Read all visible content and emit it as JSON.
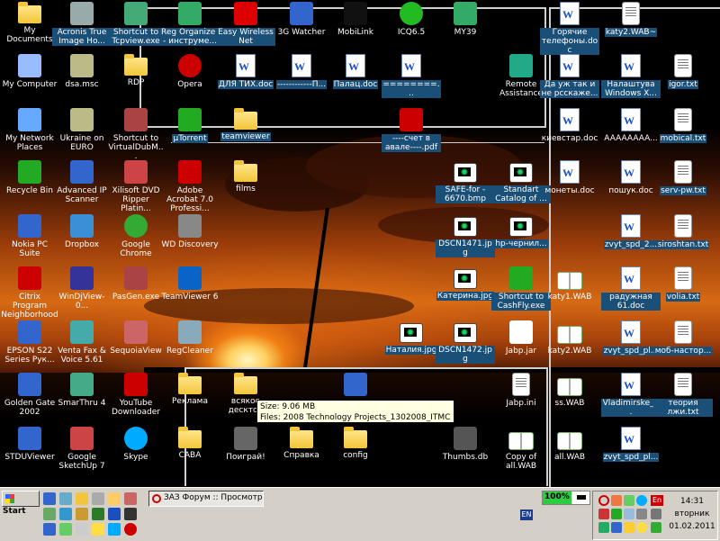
{
  "desktop": {
    "icons": [
      {
        "id": "my-documents",
        "label": "My Documents",
        "icon": "folder-docs-icon",
        "color": "#f2c53a"
      },
      {
        "id": "acronis",
        "label": "Acronis True Image Ho...",
        "icon": "acronis-disk-icon",
        "color": "#9aa"
      },
      {
        "id": "tcpview",
        "label": "Shortcut to Tcpview.exe",
        "icon": "network-icon",
        "color": "#4a7"
      },
      {
        "id": "reg-organizer",
        "label": "Reg Organizer - инструме...",
        "icon": "reg-cube-icon",
        "color": "#3a6"
      },
      {
        "id": "easy-wireless",
        "label": "Easy Wireless Net",
        "icon": "wireless-icon",
        "color": "#d00"
      },
      {
        "id": "3g-watcher",
        "label": "3G Watcher",
        "icon": "3g-icon",
        "color": "#36c"
      },
      {
        "id": "mobilink",
        "label": "MobiLink",
        "icon": "mobilink-icon",
        "color": "#111"
      },
      {
        "id": "icq",
        "label": "ICQ6.5",
        "icon": "icq-flower-icon",
        "color": "#2b2"
      },
      {
        "id": "my39",
        "label": "MY39",
        "icon": "network-globe-icon",
        "color": "#3a6"
      },
      {
        "id": "goryachie",
        "label": "Горячие телефоны.doc",
        "icon": "word-doc-icon",
        "color": "#1b4fbd"
      },
      {
        "id": "katy2-wab-tilde",
        "label": "katy2.WAB~",
        "icon": "wab-file-icon",
        "color": "#fff"
      },
      {
        "id": "my-computer",
        "label": "My Computer",
        "icon": "computer-icon",
        "color": "#9bf"
      },
      {
        "id": "dsa-msc",
        "label": "dsa.msc",
        "icon": "msc-icon",
        "color": "#bb8"
      },
      {
        "id": "rdp",
        "label": "RDP",
        "icon": "folder-icon",
        "color": "#f2c53a"
      },
      {
        "id": "opera",
        "label": "Opera",
        "icon": "opera-icon",
        "color": "#c00"
      },
      {
        "id": "dlya-tih",
        "label": "ДЛЯ ТИХ.doc",
        "icon": "word-doc-icon",
        "color": "#1b4fbd"
      },
      {
        "id": "dash-p",
        "label": "------------П...",
        "icon": "word-doc-icon",
        "color": "#1b4fbd"
      },
      {
        "id": "palats",
        "label": "Палац.doc",
        "icon": "word-doc-icon",
        "color": "#1b4fbd"
      },
      {
        "id": "equals",
        "label": "========...",
        "icon": "word-doc-icon",
        "color": "#1b4fbd"
      },
      {
        "id": "remote-assist",
        "label": "Remote Assistance",
        "icon": "remote-assistance-icon",
        "color": "#2a8"
      },
      {
        "id": "da-uzh",
        "label": "Да уж так и не рсскаже...",
        "icon": "word-doc-icon",
        "color": "#1b4fbd"
      },
      {
        "id": "nalashtuv",
        "label": "Налаштува Windows X...",
        "icon": "word-doc-icon",
        "color": "#1b4fbd"
      },
      {
        "id": "igor-txt",
        "label": "igor.txt",
        "icon": "text-file-icon",
        "color": "#fff"
      },
      {
        "id": "my-network",
        "label": "My Network Places",
        "icon": "network-places-icon",
        "color": "#6af"
      },
      {
        "id": "ukraine-euro",
        "label": "Ukraine on EURO",
        "icon": "msc-icon",
        "color": "#bb8"
      },
      {
        "id": "virtualdub",
        "label": "Shortcut to VirtualDubM...",
        "icon": "virtualdub-icon",
        "color": "#a44"
      },
      {
        "id": "utorrent",
        "label": "µTorrent",
        "icon": "utorrent-icon",
        "color": "#2a2"
      },
      {
        "id": "teamviewer-folder",
        "label": "teamviewer",
        "icon": "folder-icon",
        "color": "#f2c53a"
      },
      {
        "id": "schet-pdf",
        "label": "----счет в авале----.pdf",
        "icon": "pdf-icon",
        "color": "#c00"
      },
      {
        "id": "kyivstar",
        "label": "киевстар.doc",
        "icon": "word-doc-icon",
        "color": "#1b4fbd"
      },
      {
        "id": "aaaaa",
        "label": "AAAAAAAA...",
        "icon": "word-doc-icon",
        "color": "#1b4fbd"
      },
      {
        "id": "mobical",
        "label": "mobical.txt",
        "icon": "text-file-icon",
        "color": "#fff"
      },
      {
        "id": "recycle",
        "label": "Recycle Bin",
        "icon": "recycle-bin-icon",
        "color": "#2a2"
      },
      {
        "id": "adv-ip",
        "label": "Advanced IP Scanner",
        "icon": "ip-scanner-icon",
        "color": "#36c"
      },
      {
        "id": "xilisoft",
        "label": "Xilisoft DVD Ripper Platin...",
        "icon": "dvd-ripper-icon",
        "color": "#c44"
      },
      {
        "id": "acrobat",
        "label": "Adobe Acrobat 7.0 Professi...",
        "icon": "acrobat-icon",
        "color": "#c00"
      },
      {
        "id": "films",
        "label": "films",
        "icon": "folder-icon",
        "color": "#f2c53a"
      },
      {
        "id": "safe-for",
        "label": "SAFE-for - 6670.bmp",
        "icon": "image-file-icon",
        "color": "#fff"
      },
      {
        "id": "standart-catalog",
        "label": "Standart Catalog of ...",
        "icon": "djvu-icon",
        "color": "#fff"
      },
      {
        "id": "monety",
        "label": "монеты.doc",
        "icon": "word-doc-icon",
        "color": "#1b4fbd"
      },
      {
        "id": "poshuk",
        "label": "пошук.doc",
        "icon": "word-doc-icon",
        "color": "#1b4fbd"
      },
      {
        "id": "serv-pw",
        "label": "serv-pw.txt",
        "icon": "text-file-icon",
        "color": "#fff"
      },
      {
        "id": "nokia-pc",
        "label": "Nokia PC Suite",
        "icon": "nokia-icon",
        "color": "#36c"
      },
      {
        "id": "dropbox",
        "label": "Dropbox",
        "icon": "dropbox-icon",
        "color": "#3a8fd6"
      },
      {
        "id": "chrome",
        "label": "Google Chrome",
        "icon": "chrome-icon",
        "color": "#3a3"
      },
      {
        "id": "wd-discovery",
        "label": "WD Discovery",
        "icon": "magnifier-icon",
        "color": "#888"
      },
      {
        "id": "dscn1471",
        "label": "DSCN1471.jpg",
        "icon": "image-file-icon",
        "color": "#fff"
      },
      {
        "id": "hp-chernil",
        "label": "hp-чернил...",
        "icon": "image-file-icon",
        "color": "#fff"
      },
      {
        "id": "zvyt-spd-2",
        "label": "zvyt_spd_2...",
        "icon": "word-doc-icon",
        "color": "#1b4fbd"
      },
      {
        "id": "siroshtan",
        "label": "siroshtan.txt",
        "icon": "text-file-icon",
        "color": "#fff"
      },
      {
        "id": "citrix",
        "label": "Citrix Program Neighborhood",
        "icon": "citrix-icon",
        "color": "#c00"
      },
      {
        "id": "windjview",
        "label": "WinDjView-0...",
        "icon": "windjview-icon",
        "color": "#339"
      },
      {
        "id": "pasgen",
        "label": "PasGen.exe",
        "icon": "pasgen-icon",
        "color": "#a44"
      },
      {
        "id": "teamviewer6",
        "label": "TeamViewer 6",
        "icon": "teamviewer-icon",
        "color": "#0a64c8"
      },
      {
        "id": "katerina",
        "label": "Катерина.jpg",
        "icon": "image-file-icon",
        "color": "#fff"
      },
      {
        "id": "cashfly",
        "label": "Shortcut to CashFly.exe",
        "icon": "cashfly-icon",
        "color": "#2a2"
      },
      {
        "id": "katy1-wab",
        "label": "katy1.WAB",
        "icon": "address-book-icon",
        "color": "#fff"
      },
      {
        "id": "radujnaya",
        "label": "радужная 61.doc",
        "icon": "word-doc-icon",
        "color": "#1b4fbd"
      },
      {
        "id": "volia",
        "label": "volia.txt",
        "icon": "text-file-icon",
        "color": "#fff"
      },
      {
        "id": "epson",
        "label": "EPSON S22 Series Рук...",
        "icon": "epson-icon",
        "color": "#36c"
      },
      {
        "id": "venta-fax",
        "label": "Venta Fax & Voice 5.61",
        "icon": "fax-icon",
        "color": "#4aa"
      },
      {
        "id": "sequoia",
        "label": "SequoiaView",
        "icon": "sequoia-icon",
        "color": "#c66"
      },
      {
        "id": "regcleaner",
        "label": "RegCleaner",
        "icon": "regcleaner-icon",
        "color": "#8ab"
      },
      {
        "id": "nataliya",
        "label": "Наталия.jpg",
        "icon": "image-file-icon",
        "color": "#fff"
      },
      {
        "id": "dscn1472",
        "label": "DSCN1472.jpg",
        "icon": "image-file-icon",
        "color": "#fff"
      },
      {
        "id": "jabp-jar",
        "label": "Jabp.jar",
        "icon": "jar-icon",
        "color": "#fff"
      },
      {
        "id": "katy2-wab",
        "label": "katy2.WAB",
        "icon": "address-book-icon",
        "color": "#fff"
      },
      {
        "id": "zvyt-spd-pl",
        "label": "zvyt_spd_pl...",
        "icon": "word-doc-icon",
        "color": "#1b4fbd"
      },
      {
        "id": "mob-nastor",
        "label": "моб-настор...",
        "icon": "text-file-icon",
        "color": "#fff"
      },
      {
        "id": "golden-gate",
        "label": "Golden Gate 2002",
        "icon": "golden-gate-icon",
        "color": "#36c"
      },
      {
        "id": "smarthru",
        "label": "SmarThru 4",
        "icon": "smarthru-icon",
        "color": "#4a8"
      },
      {
        "id": "youtube-dl",
        "label": "YouTube Downloader",
        "icon": "youtube-downloader-icon",
        "color": "#c00"
      },
      {
        "id": "reklama",
        "label": "Реклама",
        "icon": "folder-icon",
        "color": "#f2c53a"
      },
      {
        "id": "vsyakoe",
        "label": "всякое десктоп",
        "icon": "folder-icon",
        "color": "#f2c53a"
      },
      {
        "id": "ie-icon",
        "label": "",
        "icon": "internet-explorer-icon",
        "color": "#36c"
      },
      {
        "id": "jabp-ini",
        "label": "Jabp.ini",
        "icon": "ini-file-icon",
        "color": "#fff"
      },
      {
        "id": "ss-wab",
        "label": "ss.WAB",
        "icon": "address-book-icon",
        "color": "#fff"
      },
      {
        "id": "vladimirske",
        "label": "Vladimirske_...",
        "icon": "word-doc-icon",
        "color": "#1b4fbd"
      },
      {
        "id": "teoriya",
        "label": "теория лжи.txt",
        "icon": "text-file-icon",
        "color": "#fff"
      },
      {
        "id": "stduviewer",
        "label": "STDUViewer",
        "icon": "stduviewer-icon",
        "color": "#36c"
      },
      {
        "id": "sketchup",
        "label": "Google SketchUp 7",
        "icon": "sketchup-icon",
        "color": "#c44"
      },
      {
        "id": "skype",
        "label": "Skype",
        "icon": "skype-icon",
        "color": "#0af"
      },
      {
        "id": "caba",
        "label": "CABA",
        "icon": "folder-icon",
        "color": "#f2c53a"
      },
      {
        "id": "pograi",
        "label": "Поиграй!",
        "icon": "gamepad-icon",
        "color": "#666"
      },
      {
        "id": "spravka",
        "label": "Справка",
        "icon": "folder-icon",
        "color": "#f2c53a"
      },
      {
        "id": "config",
        "label": "config",
        "icon": "folder-icon",
        "color": "#f2c53a"
      },
      {
        "id": "thumbs-db",
        "label": "Thumbs.db",
        "icon": "database-file-icon",
        "color": "#555"
      },
      {
        "id": "copy-of-all",
        "label": "Copy of all.WAB",
        "icon": "address-book-icon",
        "color": "#fff"
      },
      {
        "id": "all-wab",
        "label": "all.WAB",
        "icon": "address-book-icon",
        "color": "#fff"
      },
      {
        "id": "zvyt-spd-pl2",
        "label": "zvyt_spd_pl...",
        "icon": "word-doc-icon",
        "color": "#1b4fbd"
      }
    ],
    "tooltip": {
      "line1": "Size: 9.06 MB",
      "line2": "Files: 2008 Technology Projects_1302008_ITMC.ppt, ..."
    }
  },
  "taskbar": {
    "start_label": "Start",
    "task_button_label": "ЗАЗ Форум :: Просмотр ...",
    "language": "EN",
    "battery_percent": "100%",
    "clock_time": "14:31",
    "clock_day": "вторник",
    "clock_date": "01.02.2011",
    "tray_lang_badge": "En"
  }
}
